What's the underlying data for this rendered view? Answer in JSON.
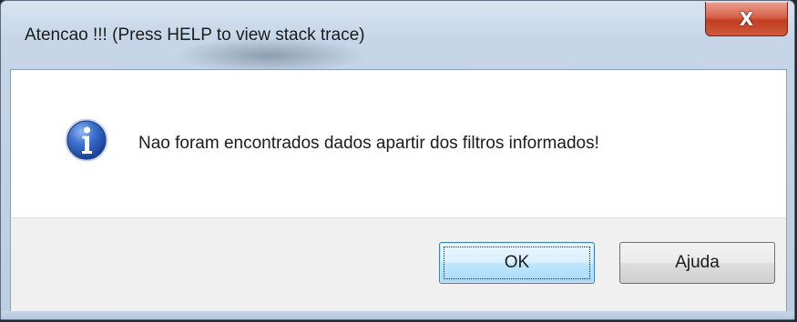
{
  "window": {
    "title": "Atencao !!!  (Press HELP to view stack trace)",
    "close_glyph": "X"
  },
  "dialog": {
    "icon": "info-icon",
    "message": "Nao foram encontrados dados apartir dos filtros informados!"
  },
  "buttons": {
    "ok_label": "OK",
    "help_label": "Ajuda"
  },
  "colors": {
    "close_button": "#c23d22",
    "ok_button_border": "#3c7fb1",
    "info_icon": "#2b5fb7"
  }
}
